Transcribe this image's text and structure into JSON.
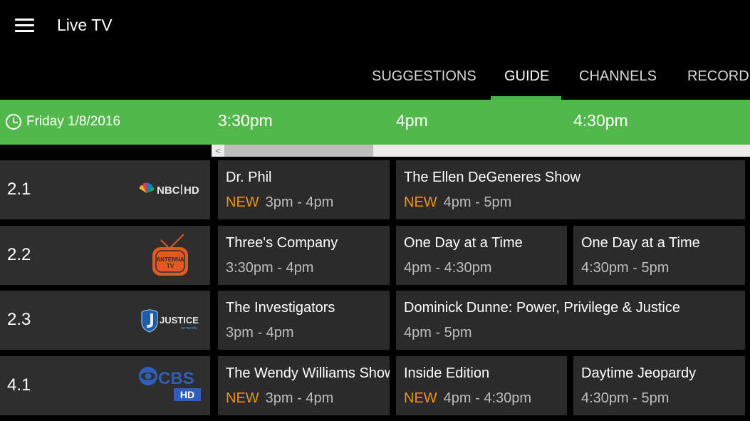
{
  "app": {
    "title": "Live TV"
  },
  "tabs": [
    {
      "label": "SUGGESTIONS"
    },
    {
      "label": "GUIDE"
    },
    {
      "label": "CHANNELS"
    },
    {
      "label": "RECORDI"
    }
  ],
  "timebar": {
    "date": "Friday 1/8/2016",
    "times": [
      "3:30pm",
      "4pm",
      "4:30pm"
    ]
  },
  "scrollbar": {
    "left_arrow": "<"
  },
  "colors": {
    "accent": "#52b84b",
    "new_badge": "#f0921c",
    "cell_bg": "#2b2b2b",
    "channel_bg": "#2e2e2e"
  },
  "channels": [
    {
      "number": "2.1",
      "logo": "nbc-hd-logo",
      "programs": [
        {
          "title": "Dr. Phil",
          "new": "NEW",
          "time": "3pm - 4pm"
        },
        {
          "title": "The Ellen DeGeneres Show",
          "new": "NEW",
          "time": "4pm - 5pm"
        }
      ]
    },
    {
      "number": "2.2",
      "logo": "antenna-tv-logo",
      "programs": [
        {
          "title": "Three's Company",
          "time": "3:30pm - 4pm"
        },
        {
          "title": "One Day at a Time",
          "time": "4pm - 4:30pm"
        },
        {
          "title": "One Day at a Time",
          "time": "4:30pm - 5pm"
        }
      ]
    },
    {
      "number": "2.3",
      "logo": "justice-network-logo",
      "programs": [
        {
          "title": "The Investigators",
          "time": "3pm - 4pm"
        },
        {
          "title": "Dominick Dunne: Power, Privilege & Justice",
          "time": "4pm - 5pm"
        }
      ]
    },
    {
      "number": "4.1",
      "logo": "cbs-hd-logo",
      "programs": [
        {
          "title": "The Wendy Williams Show",
          "new": "NEW",
          "time": "3pm - 4pm"
        },
        {
          "title": "Inside Edition",
          "new": "NEW",
          "time": "4pm - 4:30pm"
        },
        {
          "title": "Daytime Jeopardy",
          "time": "4:30pm - 5pm"
        }
      ]
    }
  ],
  "logos": {
    "nbc": {
      "text": "NBC",
      "suffix": "HD"
    },
    "antenna": {
      "text1": "ANTENNA",
      "text2": "TV"
    },
    "justice": {
      "text": "JUSTICE",
      "sub": "NETWORK"
    },
    "cbs": {
      "text": "CBS",
      "suffix": "HD"
    }
  }
}
